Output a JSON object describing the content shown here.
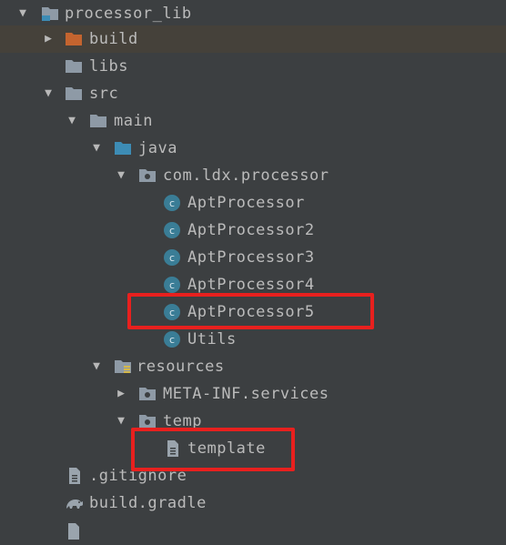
{
  "tree": [
    {
      "label": "processor_lib",
      "icon": "module-folder-icon",
      "expanded": true
    },
    {
      "label": "build",
      "icon": "build-folder-icon",
      "expanded": false,
      "selected": true
    },
    {
      "label": "libs",
      "icon": "folder-icon"
    },
    {
      "label": "src",
      "icon": "folder-icon",
      "expanded": true
    },
    {
      "label": "main",
      "icon": "folder-icon",
      "expanded": true
    },
    {
      "label": "java",
      "icon": "source-folder-icon",
      "expanded": true
    },
    {
      "label": "com.ldx.processor",
      "icon": "package-icon",
      "expanded": true
    },
    {
      "label": "AptProcessor",
      "icon": "class-icon"
    },
    {
      "label": "AptProcessor2",
      "icon": "class-icon"
    },
    {
      "label": "AptProcessor3",
      "icon": "class-icon"
    },
    {
      "label": "AptProcessor4",
      "icon": "class-icon"
    },
    {
      "label": "AptProcessor5",
      "icon": "class-icon"
    },
    {
      "label": "Utils",
      "icon": "class-icon"
    },
    {
      "label": "resources",
      "icon": "resources-folder-icon",
      "expanded": true
    },
    {
      "label": "META-INF.services",
      "icon": "package-icon",
      "expanded": false
    },
    {
      "label": "temp",
      "icon": "package-icon",
      "expanded": true
    },
    {
      "label": "template",
      "icon": "file-icon"
    },
    {
      "label": ".gitignore",
      "icon": "file-icon"
    },
    {
      "label": "build.gradle",
      "icon": "gradle-icon"
    }
  ],
  "class_badge_letter": "c",
  "colors": {
    "background": "#3c3f41",
    "selected_row": "#45413a",
    "text": "#bbbbbb",
    "folder": "#8e9aa6",
    "build_folder": "#c4642f",
    "source_folder": "#3d8cb5",
    "class_icon": "#3a7d96",
    "highlight": "#e8201e"
  }
}
